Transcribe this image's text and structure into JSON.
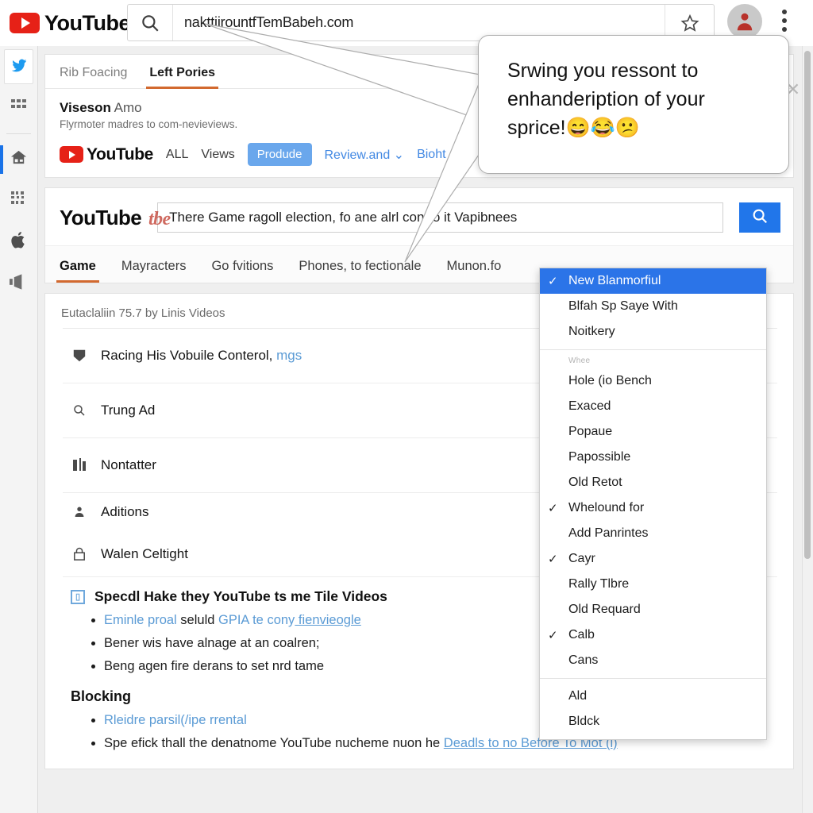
{
  "browser": {
    "brand": "YouTube",
    "url": "nakttiirountfTemBabeh.com",
    "search_icon": "search-icon",
    "star_icon": "star-icon",
    "menu_icon": "kebab-menu-icon",
    "avatar_icon": "user-avatar"
  },
  "rail": {
    "items": [
      {
        "name": "twitter-icon",
        "glyph": "twitter"
      },
      {
        "name": "grid-apps-icon",
        "glyph": "grid"
      },
      {
        "name": "home-icon",
        "glyph": "home"
      },
      {
        "name": "qr-code-icon",
        "glyph": "qr"
      },
      {
        "name": "apple-icon",
        "glyph": "apple"
      },
      {
        "name": "speaker-icon",
        "glyph": "speaker"
      }
    ]
  },
  "card_tabs": {
    "tabs": [
      {
        "label": "Rib Foacing",
        "selected": false
      },
      {
        "label": "Left Pories",
        "selected": true
      }
    ]
  },
  "viseson": {
    "title_bold": "Viseson",
    "title_rest": " Amo",
    "subtitle": "Flyrmoter madres to com-nevieviews."
  },
  "chips": {
    "logo_word": "YouTube",
    "items": [
      {
        "label": "ALL",
        "style": "plain"
      },
      {
        "label": "Views",
        "style": "plain"
      },
      {
        "label": "Produde",
        "style": "pill"
      },
      {
        "label": "Review.and",
        "style": "blue-caret"
      },
      {
        "label": "Bioht",
        "style": "blue"
      }
    ]
  },
  "yt_search": {
    "brand": "YouTube",
    "scribble": "tbe",
    "query": "There Game ragoll election, fo  ane alrl contro it Vapibnees",
    "search_button_icon": "search-icon"
  },
  "yt_tabs": [
    {
      "label": "Game",
      "selected": true
    },
    {
      "label": "Mayracters",
      "selected": false
    },
    {
      "label": "Go fvitions",
      "selected": false
    },
    {
      "label": "Phones, to fectionale",
      "selected": false
    },
    {
      "label": "Munon.fo",
      "selected": false
    }
  ],
  "list": {
    "header": "Eutaclaliin 75.7  by Linis Videos",
    "rows": [
      {
        "icon": "tag-icon",
        "text": "Racing His Vobuile Conterol, ",
        "link": "mgs"
      },
      {
        "icon": "search-icon",
        "text": "Trung Ad",
        "link": ""
      },
      {
        "icon": "chart-icon",
        "text": "Nontatter",
        "link": ""
      },
      {
        "icon": "person-icon",
        "text": "Aditions",
        "link": ""
      },
      {
        "icon": "lock-icon",
        "text": "Walen Celtight",
        "link": ""
      }
    ]
  },
  "rich": {
    "heading_icon": "book-icon",
    "heading": "Specdl Hake they YouTube ts me Tile Videos",
    "bullets": [
      {
        "pre": "Eminle proal",
        "mid": " seluld ",
        "link": "GPIA te cony",
        "tail": " fienvieogle"
      },
      {
        "pre": "",
        "mid": "Bener wis have alnage at an coalren;",
        "link": "",
        "tail": ""
      },
      {
        "pre": "",
        "mid": "Beng agen fire derans to set nrd tame",
        "link": "",
        "tail": ""
      }
    ],
    "subheading": "Blocking",
    "bullets2": [
      {
        "pre": "Rleidre parsil(/ipe rrental",
        "mid": "",
        "link": "",
        "tail": ""
      },
      {
        "pre": "",
        "mid": "Spe efick thall the denatnome YouTube nucheme nuon he ",
        "link": "Deadls to no Before To Mot (i)",
        "tail": ""
      }
    ]
  },
  "menu": {
    "groups": [
      {
        "items": [
          {
            "label": "New Blanmorfiul",
            "checked": true,
            "selected": true
          },
          {
            "label": "Blfah Sp Saye With",
            "checked": false,
            "selected": false
          },
          {
            "label": "Noitkery",
            "checked": false,
            "selected": false
          }
        ]
      },
      {
        "label": "Whee",
        "items": [
          {
            "label": "Hole (io Bench",
            "checked": false,
            "selected": false
          },
          {
            "label": "Exaced",
            "checked": false,
            "selected": false
          },
          {
            "label": "Popaue",
            "checked": false,
            "selected": false
          },
          {
            "label": "Papossible",
            "checked": false,
            "selected": false
          },
          {
            "label": "Old Retot",
            "checked": false,
            "selected": false
          },
          {
            "label": "Whelound for",
            "checked": true,
            "selected": false
          },
          {
            "label": "Add Panrintes",
            "checked": false,
            "selected": false
          },
          {
            "label": "Cayr",
            "checked": true,
            "selected": false
          },
          {
            "label": "Rally Tlbre",
            "checked": false,
            "selected": false
          },
          {
            "label": "Old Requard",
            "checked": false,
            "selected": false
          },
          {
            "label": "Calb",
            "checked": true,
            "selected": false
          },
          {
            "label": "Cans",
            "checked": false,
            "selected": false
          }
        ]
      },
      {
        "items": [
          {
            "label": "Ald",
            "checked": false,
            "selected": false
          },
          {
            "label": "Bldck",
            "checked": false,
            "selected": false
          }
        ]
      }
    ]
  },
  "bubble": {
    "line1": "Srwing you ressont to",
    "line2": "enhandeription of your",
    "line3": "sprice!",
    "emojis": "😄😂😕"
  },
  "close_label": "✕",
  "colors": {
    "accent_blue": "#2b74e8",
    "youtube_red": "#e62117",
    "tab_underline": "#d2692f",
    "link_blue": "#5b9bd5"
  }
}
